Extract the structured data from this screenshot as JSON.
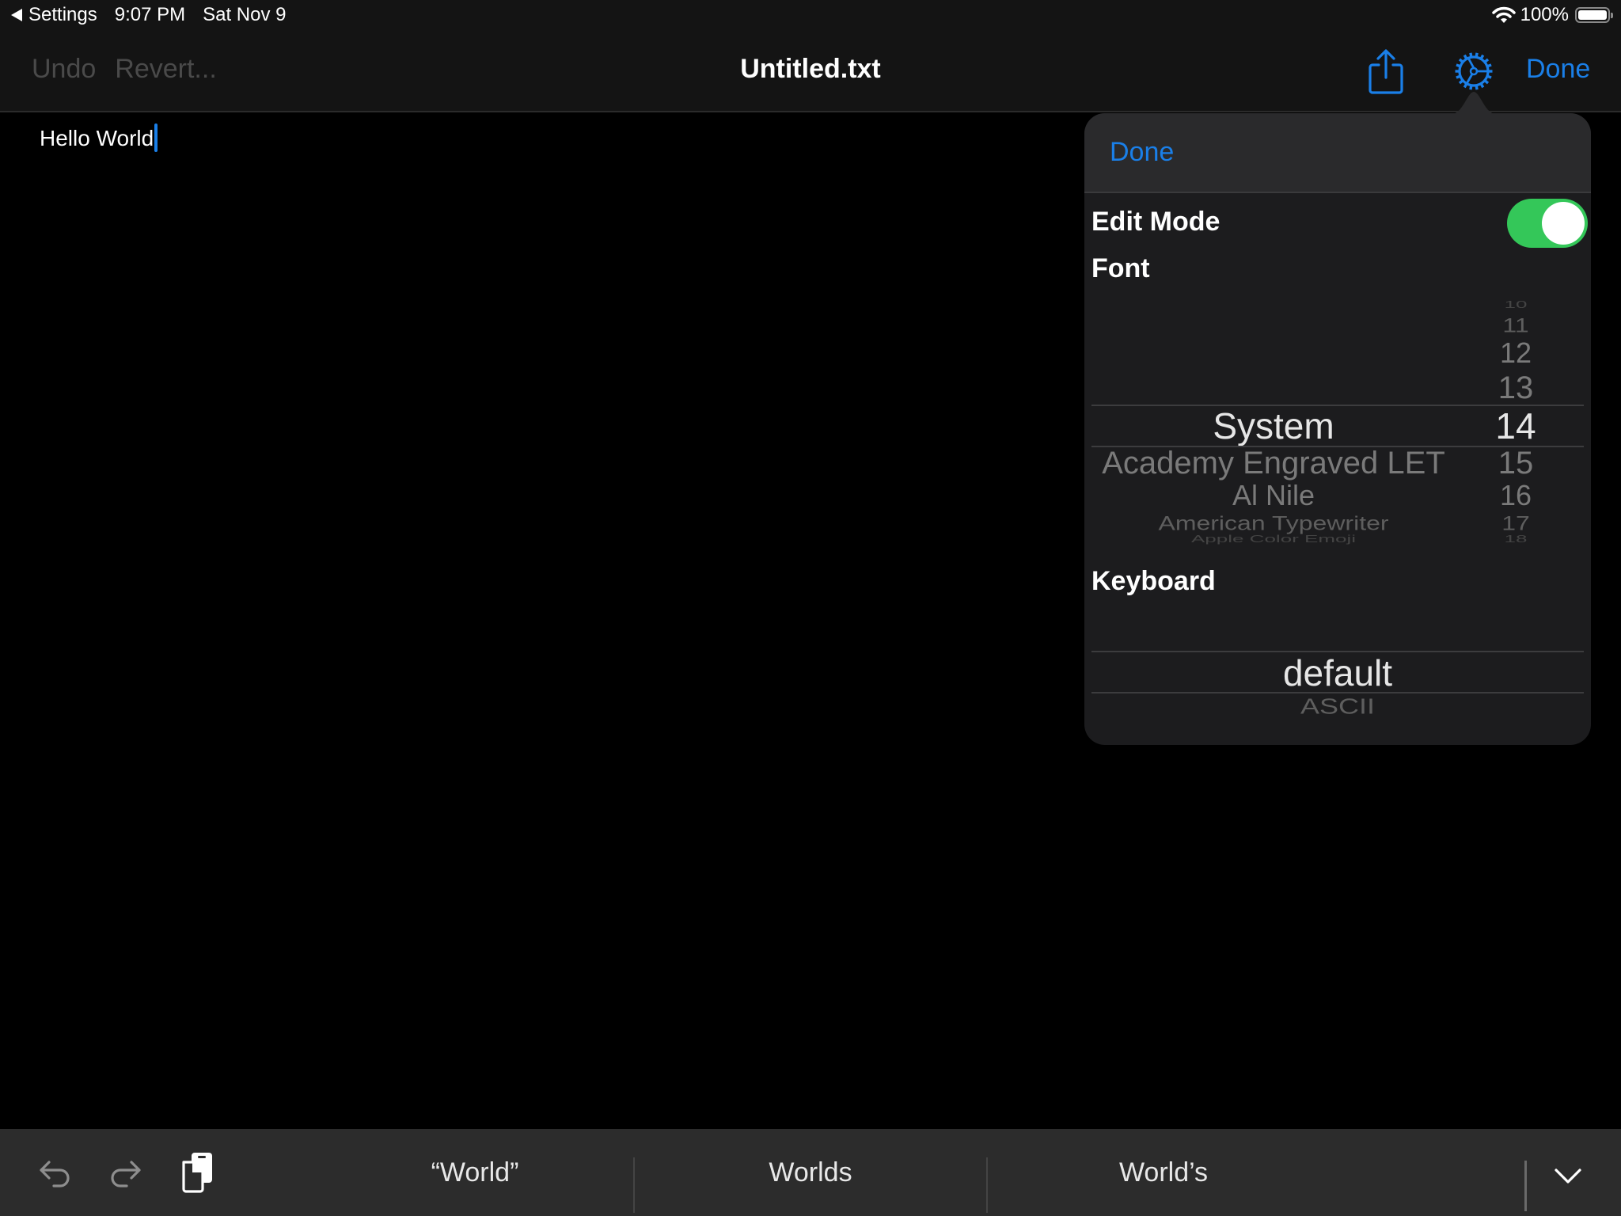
{
  "status_bar": {
    "back_app": "Settings",
    "time": "9:07 PM",
    "date": "Sat Nov 9",
    "battery": "100%",
    "battery_level": 1.0
  },
  "nav": {
    "undo": "Undo",
    "revert": "Revert...",
    "title": "Untitled.txt",
    "done": "Done",
    "icons": [
      "share-icon",
      "gear-icon"
    ]
  },
  "editor": {
    "text": "Hello World"
  },
  "settings_popover": {
    "done": "Done",
    "edit_mode_label": "Edit Mode",
    "edit_mode_on": true,
    "font_label": "Font",
    "font_picker": {
      "fonts_above": [],
      "selected_font": "System",
      "fonts_below": [
        "Academy Engraved LET",
        "Al Nile",
        "American Typewriter",
        "Apple Color Emoji"
      ],
      "sizes_above": [
        "10",
        "11",
        "12",
        "13"
      ],
      "selected_size": "14",
      "sizes_below": [
        "15",
        "16",
        "17",
        "18"
      ]
    },
    "keyboard_label": "Keyboard",
    "keyboard_picker": {
      "selected": "default",
      "below": [
        "ASCII"
      ]
    }
  },
  "keyboard_bar": {
    "suggestions": [
      "“World”",
      "Worlds",
      "World’s"
    ],
    "icons": [
      "undo-icon",
      "redo-icon",
      "paste-icon",
      "keyboard-dismiss-icon"
    ]
  },
  "colors": {
    "accent": "#1a7fe8",
    "toggle_on": "#34c759"
  }
}
